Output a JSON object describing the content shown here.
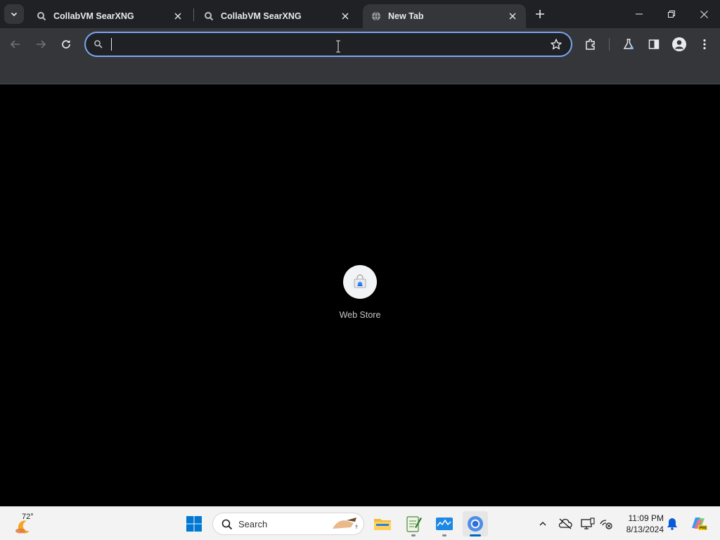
{
  "tabs": [
    {
      "title": "CollabVM SearXNG",
      "active": false
    },
    {
      "title": "CollabVM SearXNG",
      "active": false
    },
    {
      "title": "New Tab",
      "active": true
    }
  ],
  "omnibox": {
    "value": "",
    "placeholder": ""
  },
  "shortcuts": [
    {
      "label": "Web Store"
    }
  ],
  "taskbar": {
    "weather_temp": "72°",
    "search_label": "Search",
    "time": "11:09 PM",
    "date": "8/13/2024"
  },
  "colors": {
    "tabstrip_bg": "#202124",
    "toolbar_bg": "#35363a",
    "focus_ring": "#7aa7f0",
    "taskbar_bg": "#f3f3f3",
    "accent": "#0067c0"
  },
  "icons": {
    "tab_search": "chevron-down-icon",
    "tab_favicon": "searxng-icon",
    "new_tab_favicon": "globe-icon",
    "close": "close-icon",
    "new_tab": "plus-icon",
    "minimize": "minimize-icon",
    "restore": "restore-icon",
    "window_close": "window-close-icon",
    "back": "back-arrow-icon",
    "forward": "forward-arrow-icon",
    "reload": "reload-icon",
    "search": "search-icon",
    "bookmark": "star-icon",
    "extensions": "puzzle-icon",
    "labs": "flask-icon",
    "side_panel": "side-panel-icon",
    "profile": "profile-icon",
    "menu": "kebab-menu-icon"
  }
}
